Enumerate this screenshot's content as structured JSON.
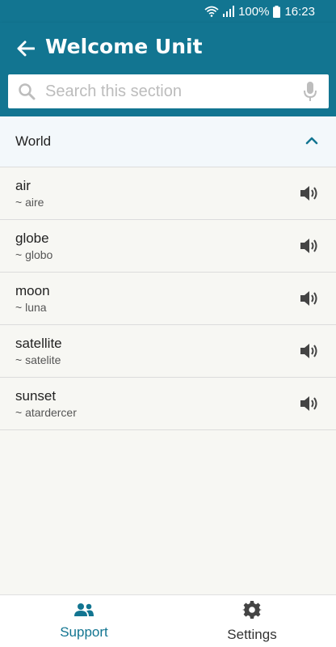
{
  "status_bar": {
    "battery": "100%",
    "time": "16:23"
  },
  "header": {
    "title": "Welcome Unit"
  },
  "search": {
    "placeholder": "Search this section"
  },
  "section": {
    "label": "World"
  },
  "words": [
    {
      "word": "air",
      "translation": "aire"
    },
    {
      "word": "globe",
      "translation": "globo"
    },
    {
      "word": "moon",
      "translation": "luna"
    },
    {
      "word": "satellite",
      "translation": "satelite"
    },
    {
      "word": "sunset",
      "translation": "atardercer"
    }
  ],
  "bottom_nav": [
    {
      "label": "Support",
      "icon": "people-icon",
      "active": true
    },
    {
      "label": "Settings",
      "icon": "gear-icon",
      "active": false
    }
  ],
  "colors": {
    "primary": "#127591",
    "background": "#f7f7f3"
  }
}
